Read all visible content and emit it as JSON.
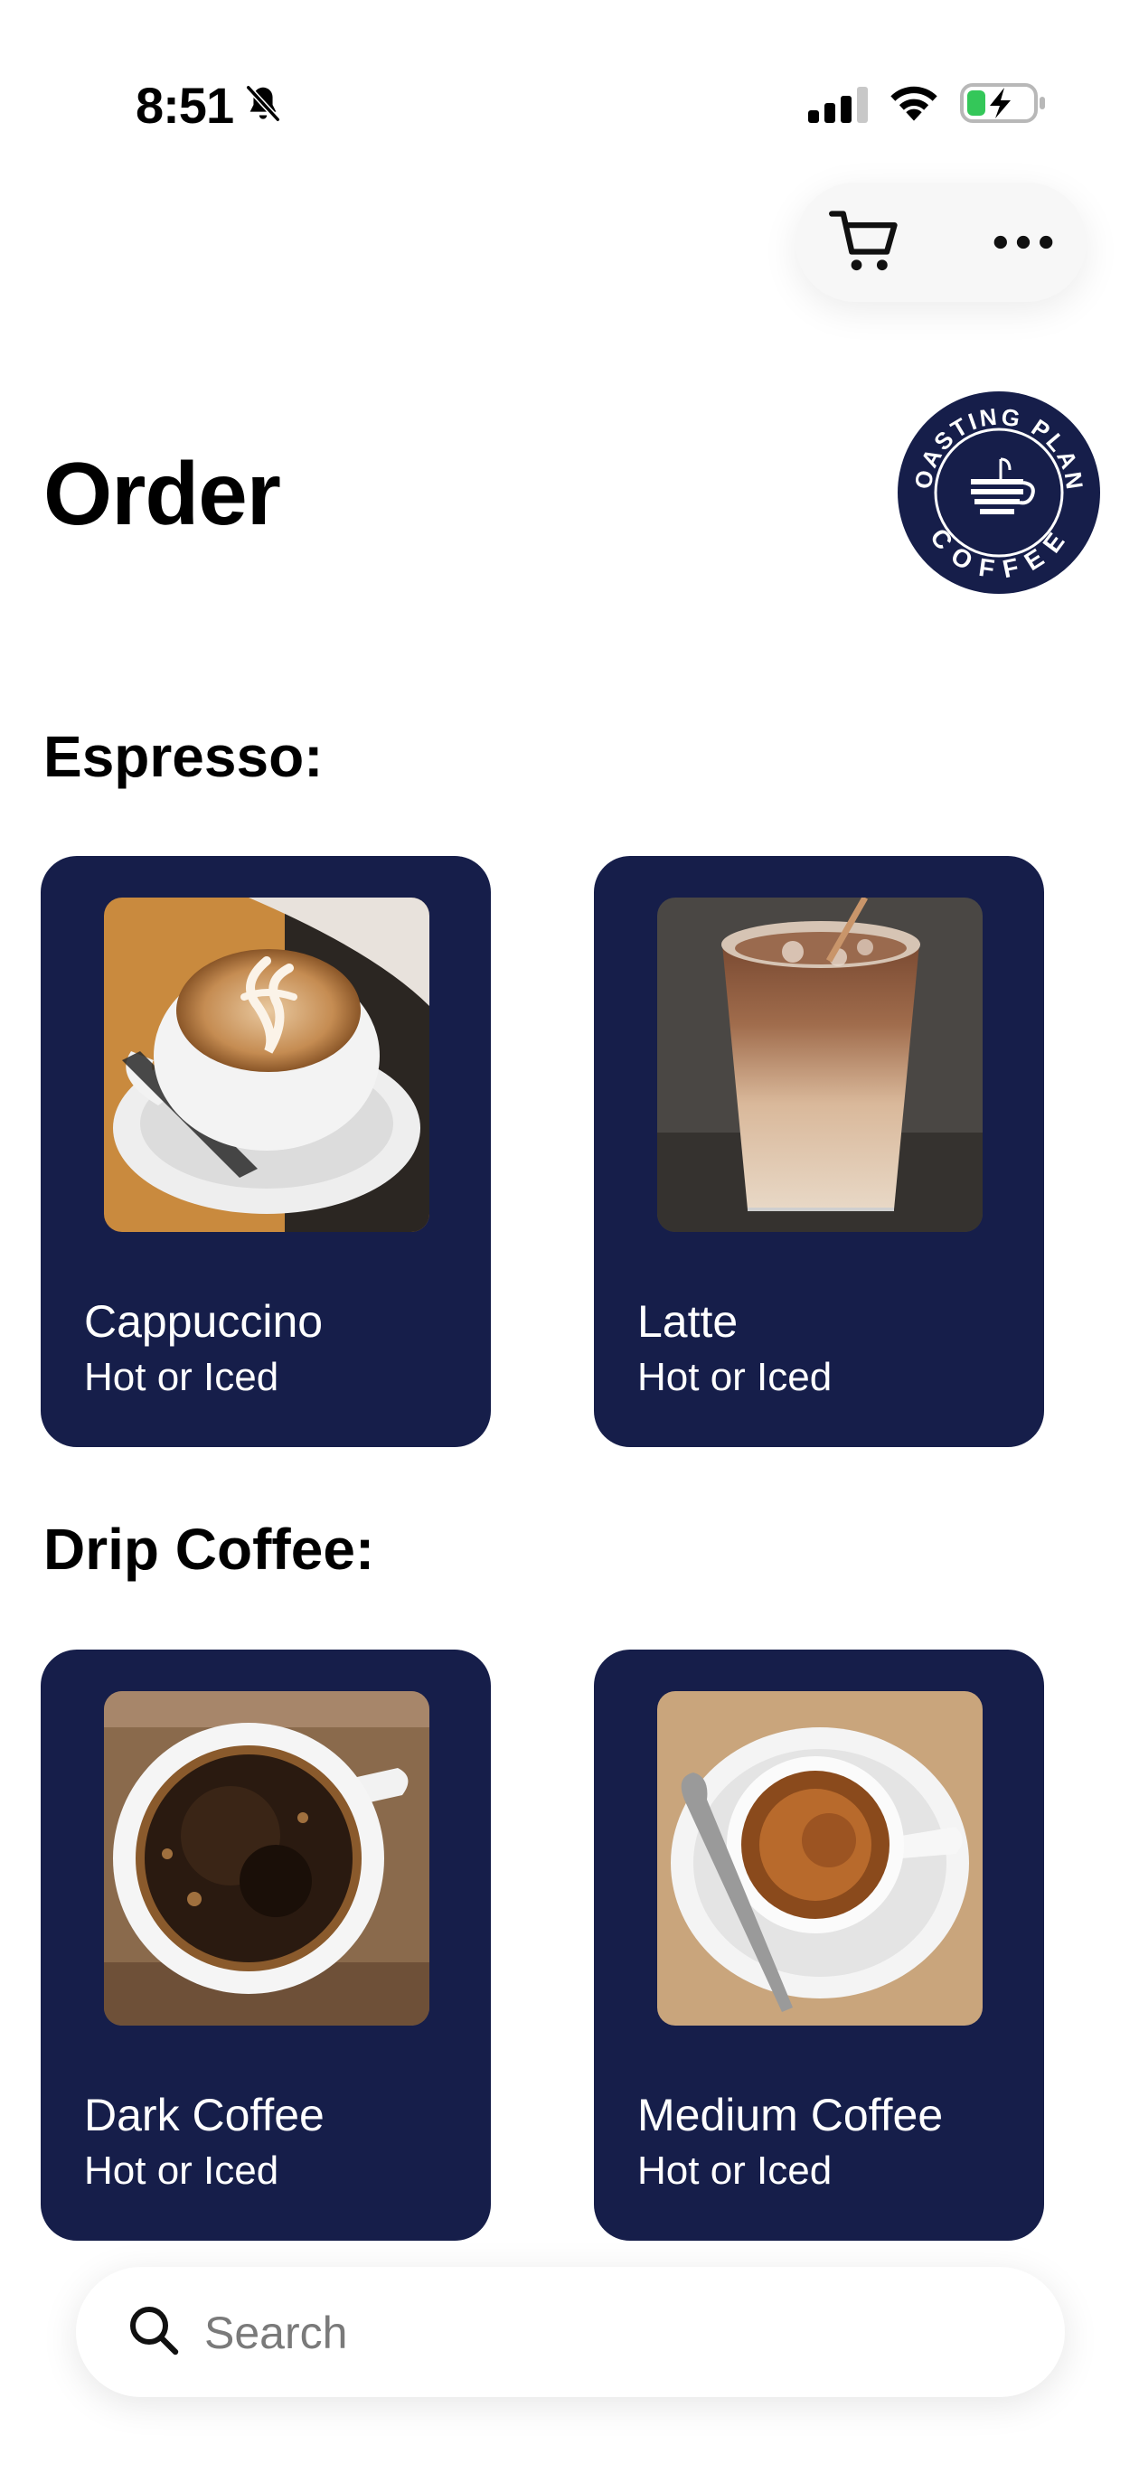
{
  "status_bar": {
    "time": "8:51",
    "icons": [
      "bell-slash-icon",
      "cellular-signal-icon",
      "wifi-icon",
      "battery-charging-icon"
    ]
  },
  "header": {
    "actions": [
      "cart-icon",
      "more-icon"
    ],
    "title": "Order"
  },
  "logo": {
    "text_top": "ROASTING PLANT",
    "text_bottom": "COFFEE",
    "color": "#161e4a"
  },
  "sections": [
    {
      "title": "Espresso:",
      "items": [
        {
          "name": "Cappuccino",
          "subtitle": "Hot or Iced"
        },
        {
          "name": "Latte",
          "subtitle": "Hot or Iced"
        }
      ]
    },
    {
      "title": "Drip Coffee:",
      "items": [
        {
          "name": "Dark Coffee",
          "subtitle": "Hot or Iced"
        },
        {
          "name": "Medium Coffee",
          "subtitle": "Hot or Iced"
        }
      ]
    }
  ],
  "search": {
    "placeholder": "Search",
    "value": ""
  },
  "colors": {
    "card_background": "#161e4a",
    "battery_charge": "#34c759"
  }
}
